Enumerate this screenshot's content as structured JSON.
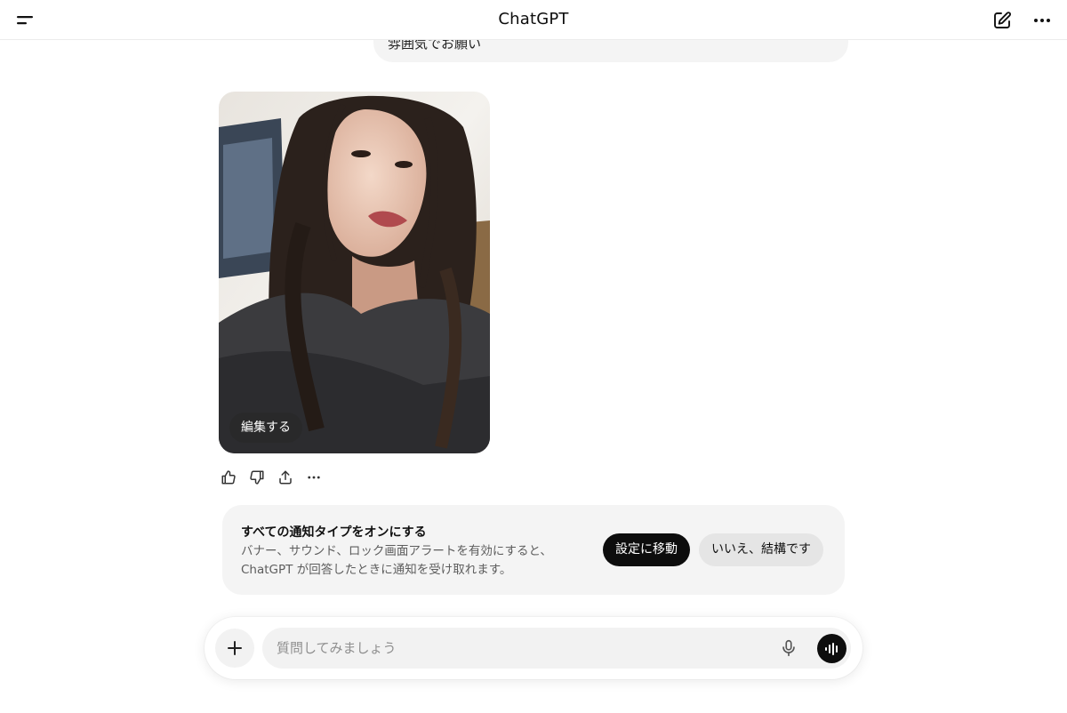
{
  "header": {
    "title": "ChatGPT",
    "left_icon": "sidebar-menu-icon",
    "right_icons": [
      "new-chat-icon",
      "more-options-icon"
    ]
  },
  "conversation": {
    "user_message_tail": "雰囲気でお願い",
    "image_edit_label": "編集する",
    "message_actions": [
      "thumbs-up-icon",
      "thumbs-down-icon",
      "share-icon",
      "more-icon"
    ]
  },
  "notification_prompt": {
    "title": "すべての通知タイプをオンにする",
    "body_line1": "バナー、サウンド、ロック画面アラートを有効にすると、",
    "body_line2": "ChatGPT が回答したときに通知を受け取れます。",
    "confirm_label": "設定に移動",
    "dismiss_label": "いいえ、結構です"
  },
  "composer": {
    "placeholder": "質問してみましょう",
    "value": "",
    "icons": [
      "plus-icon",
      "microphone-icon",
      "voice-mode-icon"
    ]
  },
  "colors": {
    "accent": "#0d0d0d",
    "bubble_bg": "#f4f4f4",
    "secondary_text": "#5d5d5d"
  }
}
